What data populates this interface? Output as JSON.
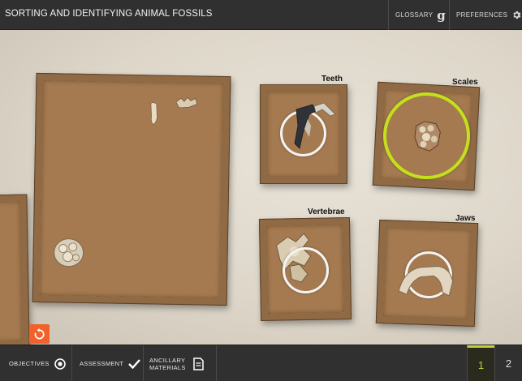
{
  "header": {
    "title": "SORTING AND IDENTIFYING ANIMAL FOSSILS",
    "glossary_label": "GLOSSARY",
    "preferences_label": "PREFERENCES"
  },
  "trays": {
    "teeth": "Teeth",
    "scales": "Scales",
    "vertebrae": "Vertebrae",
    "jaws": "Jaws"
  },
  "footer": {
    "objectives_label": "OBJECTIVES",
    "assessment_label": "ASSESSMENT",
    "ancillary_label": "ANCILLARY MATERIALS",
    "pages": [
      "1",
      "2"
    ],
    "current_page": "1"
  },
  "colors": {
    "bar": "#303030",
    "accent_selected": "#c4e01a",
    "reset_button": "#f0612b"
  },
  "icons": {
    "glossary": "glossary-g-icon",
    "preferences": "gear-icon",
    "objectives": "target-icon",
    "assessment": "checkmark-icon",
    "ancillary": "document-icon",
    "reset": "reset-arrow-icon"
  }
}
